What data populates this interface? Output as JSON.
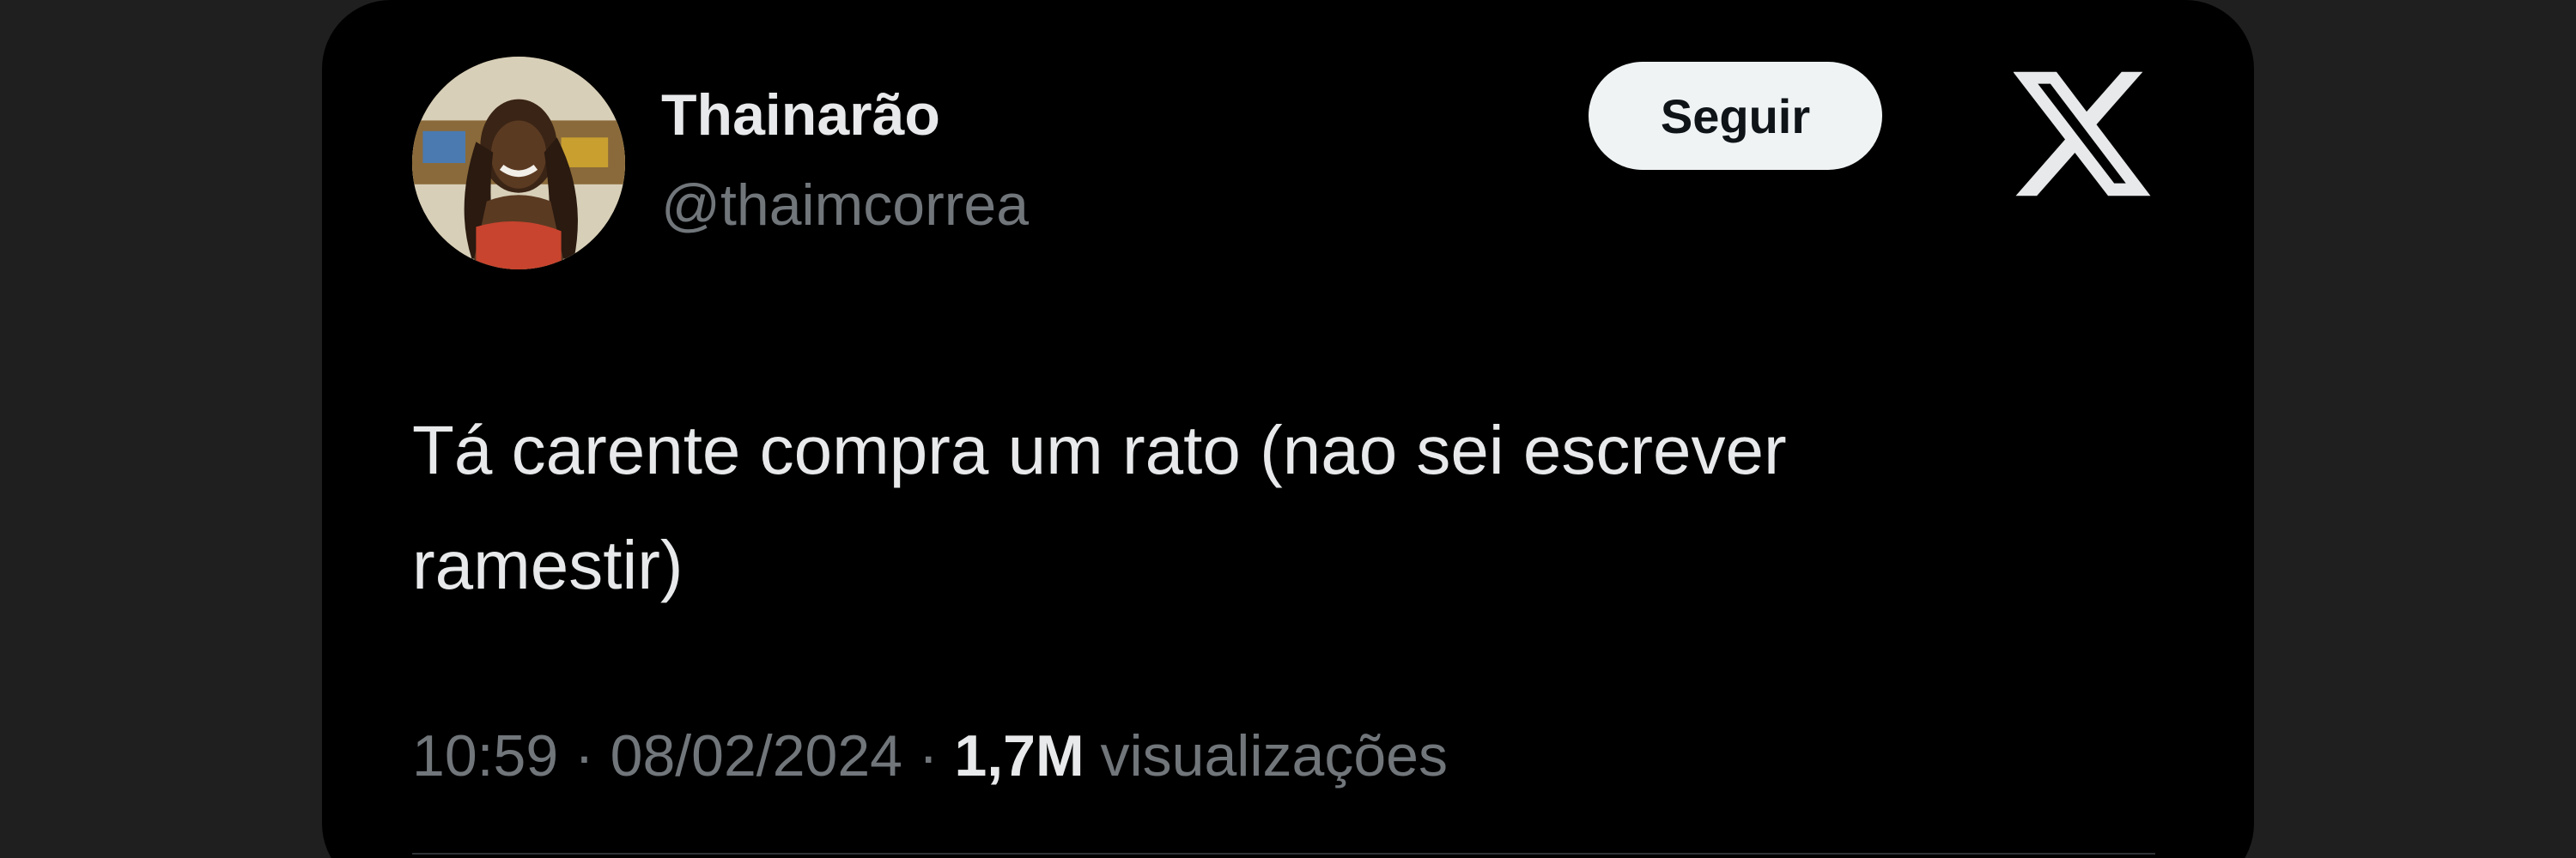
{
  "tweet": {
    "author": {
      "display_name": "Thainarão",
      "handle": "@thaimcorrea"
    },
    "follow_label": "Seguir",
    "logo": "x-logo-icon",
    "text": "Tá carente compra um rato (nao sei escrever\nramestir)",
    "meta": {
      "time": "10:59",
      "separator": "·",
      "date": "08/02/2024",
      "views_count": "1,7M",
      "views_label": "visualizações"
    }
  },
  "colors": {
    "background_outer": "#1f1f1f",
    "card_background": "#000000",
    "primary_text": "#e7e9ea",
    "secondary_text": "#71767b",
    "button_background": "#eff3f4",
    "button_text": "#0f1419"
  }
}
